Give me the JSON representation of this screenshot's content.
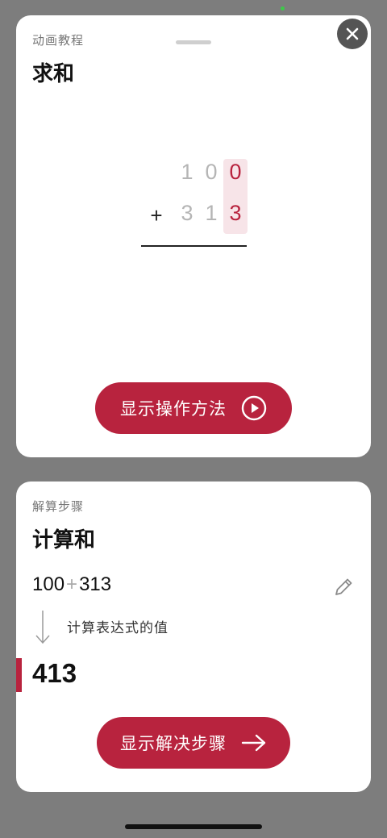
{
  "animation_card": {
    "subtitle": "动画教程",
    "title": "求和",
    "problem": {
      "addend1_digits": [
        "1",
        "0",
        "0"
      ],
      "operator": "+",
      "addend2_digits": [
        "3",
        "1",
        "3"
      ]
    },
    "show_method_button": "显示操作方法",
    "icons": {
      "close": "close-icon",
      "play": "play-icon"
    }
  },
  "steps_card": {
    "subtitle": "解算步骤",
    "title": "计算和",
    "expression": {
      "left": "100",
      "operator": "+",
      "right": "313"
    },
    "step_description": "计算表达式的值",
    "result": "413",
    "show_steps_button": "显示解决步骤",
    "icons": {
      "edit": "pencil-icon",
      "arrow_down": "arrow-down-icon",
      "arrow_right": "arrow-right-icon"
    }
  },
  "colors": {
    "accent": "#b8233e",
    "highlight_column": "#f7e4e8",
    "background": "#7d7d7d",
    "card": "#ffffff"
  }
}
